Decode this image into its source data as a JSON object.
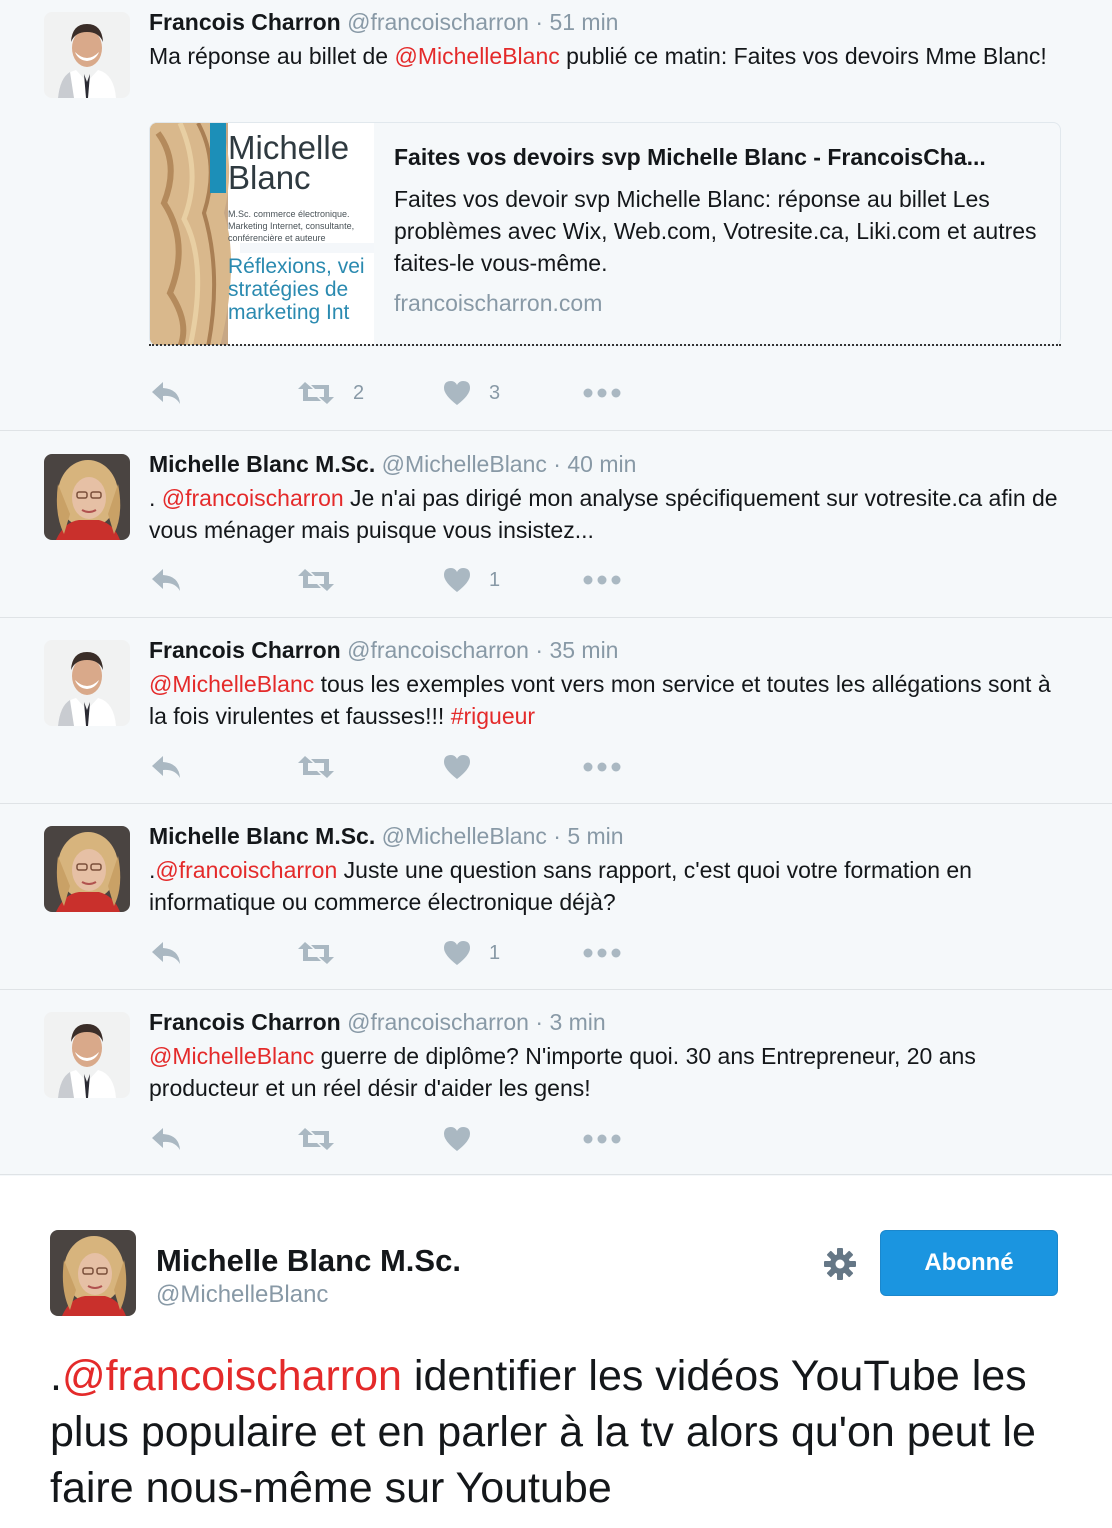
{
  "colors": {
    "mention": "#e0245e",
    "handle": "#8899a6",
    "action_icon": "#aab8c2",
    "follow_button": "#1b95e0",
    "background": "#f5f8fa"
  },
  "tweets": [
    {
      "author": "Francois Charron",
      "handle": "@francoischarron",
      "sep": "·",
      "time": "51 min",
      "text_parts": [
        "Ma réponse au billet de ",
        "@MichelleBlanc",
        " publié ce matin: Faites vos devoirs Mme Blanc!"
      ],
      "card": {
        "image_text": {
          "name_line1": "Michelle",
          "name_line2": "Blanc",
          "sub1": "M.Sc. commerce électronique.",
          "sub2": "Marketing Internet, consultante,",
          "sub3": "conférencière et auteure",
          "tag1": "Réflexions, vei",
          "tag2": "stratégies de",
          "tag3": "marketing Int"
        },
        "title": "Faites vos devoirs svp Michelle Blanc - FrancoisCha...",
        "description": "Faites vos devoir svp Michelle Blanc: réponse au billet Les problèmes avec Wix, Web.com, Votresite.ca, Liki.com et autres faites-le vous-même.",
        "domain": "francoischarron.com"
      },
      "actions": {
        "reply_icon": "reply-icon",
        "retweet_icon": "retweet-icon",
        "retweets": "2",
        "like_icon": "heart-icon",
        "likes": "3",
        "more_icon": "more-icon"
      }
    },
    {
      "author": "Michelle Blanc M.Sc.",
      "handle": "@MichelleBlanc",
      "sep": "·",
      "time": "40 min",
      "text_parts": [
        ". ",
        "@francoischarron",
        " Je n'ai pas dirigé mon analyse spécifiquement sur votresite.ca afin de vous ménager mais puisque vous insistez..."
      ],
      "actions": {
        "retweets": "",
        "likes": "1"
      }
    },
    {
      "author": "Francois Charron",
      "handle": "@francoischarron",
      "sep": "·",
      "time": "35 min",
      "text_parts": [
        "",
        "@MichelleBlanc",
        " tous les exemples vont vers mon service et toutes les allégations sont à la fois virulentes et fausses!!! ",
        "#rigueur"
      ],
      "actions": {
        "retweets": "",
        "likes": ""
      }
    },
    {
      "author": "Michelle Blanc M.Sc.",
      "handle": "@MichelleBlanc",
      "sep": "·",
      "time": "5 min",
      "text_parts": [
        ".",
        "@francoischarron",
        " Juste une question sans rapport, c'est quoi votre formation en informatique ou commerce électronique déjà?"
      ],
      "actions": {
        "retweets": "",
        "likes": "1"
      }
    },
    {
      "author": "Francois Charron",
      "handle": "@francoischarron",
      "sep": "·",
      "time": "3 min",
      "text_parts": [
        "",
        "@MichelleBlanc",
        " guerre de diplôme? N'importe quoi. 30 ans Entrepreneur, 20 ans producteur et un réel désir d'aider les gens!"
      ],
      "actions": {
        "retweets": "",
        "likes": ""
      }
    }
  ],
  "featured": {
    "author": "Michelle Blanc M.Sc.",
    "handle": "@MichelleBlanc",
    "gear_icon": "gear-icon",
    "follow_label": "Abonné",
    "text_prefix": ".",
    "mention": "@francoischarron",
    "text_rest": " identifier les vidéos YouTube les plus populaire et en parler à la tv alors qu'on peut le faire nous-même sur Youtube"
  }
}
